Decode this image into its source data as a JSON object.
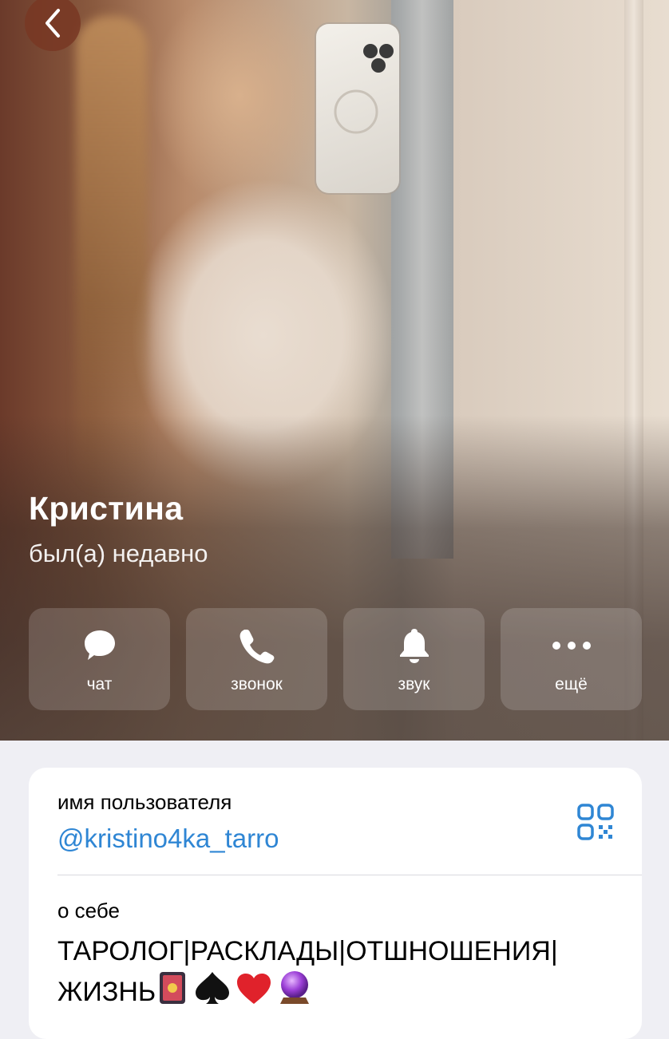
{
  "profile": {
    "name": "Кристина",
    "status": "был(а) недавно"
  },
  "actions": [
    {
      "label": "чат",
      "icon": "chat-bubble-icon"
    },
    {
      "label": "звонок",
      "icon": "phone-icon"
    },
    {
      "label": "звук",
      "icon": "bell-icon"
    },
    {
      "label": "ещё",
      "icon": "more-dots-icon"
    }
  ],
  "info": {
    "username_label": "имя пользователя",
    "username": "@kristino4ka_tarro",
    "about_label": "о себе",
    "about_text": "ТАРОЛОГ|РАСКЛАДЫ|ОТШНОШЕНИЯ|ЖИЗНЬ",
    "about_emoji": [
      "tarot-card-icon",
      "spade-icon",
      "heart-icon",
      "crystal-ball-icon"
    ]
  },
  "colors": {
    "link": "#2f86d4",
    "background": "#efeff4",
    "card": "#ffffff"
  }
}
